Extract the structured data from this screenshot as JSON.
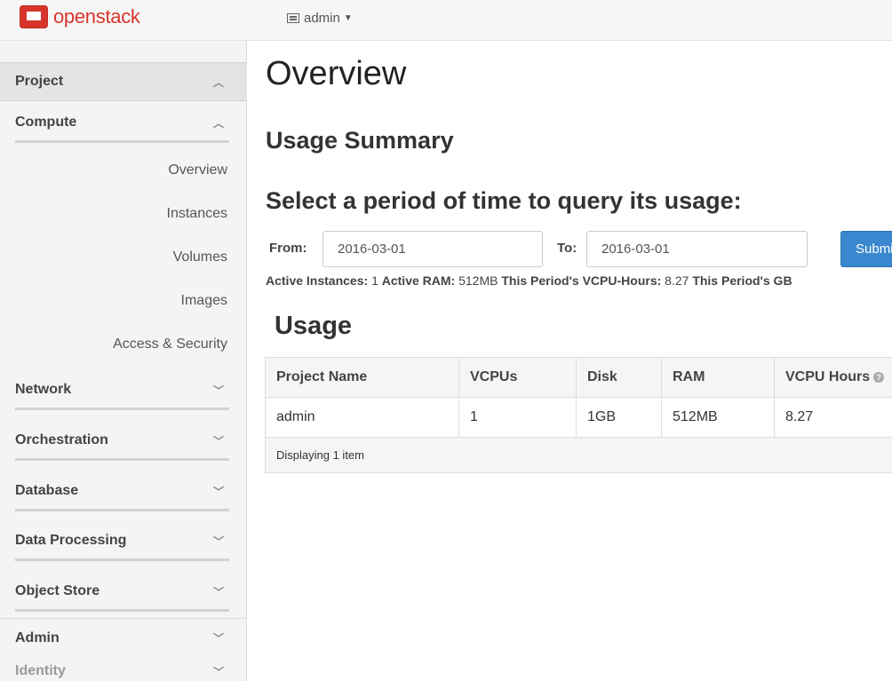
{
  "header": {
    "brand": "openstack",
    "project_selector": "admin"
  },
  "sidebar": {
    "project": "Project",
    "compute": "Compute",
    "compute_items": [
      "Overview",
      "Instances",
      "Volumes",
      "Images",
      "Access & Security"
    ],
    "groups": [
      "Network",
      "Orchestration",
      "Database",
      "Data Processing",
      "Object Store"
    ],
    "admin": "Admin",
    "identity": "Identity"
  },
  "main": {
    "title": "Overview",
    "usage_summary": "Usage Summary",
    "period_heading": "Select a period of time to query its usage:",
    "from_label": "From:",
    "from_value": "2016-03-01",
    "to_label": "To:",
    "to_value": "2016-03-01",
    "submit_label": "Submit",
    "stats": {
      "active_instances_label": "Active Instances:",
      "active_instances_value": "1",
      "active_ram_label": "Active RAM:",
      "active_ram_value": "512MB",
      "vcpu_hours_label": "This Period's VCPU-Hours:",
      "vcpu_hours_value": "8.27",
      "gb_hours_label": "This Period's GB"
    },
    "usage_heading": "Usage",
    "table": {
      "headers": [
        "Project Name",
        "VCPUs",
        "Disk",
        "RAM",
        "VCPU Hours"
      ],
      "rows": [
        [
          "admin",
          "1",
          "1GB",
          "512MB",
          "8.27"
        ]
      ],
      "footer": "Displaying 1 item"
    }
  }
}
